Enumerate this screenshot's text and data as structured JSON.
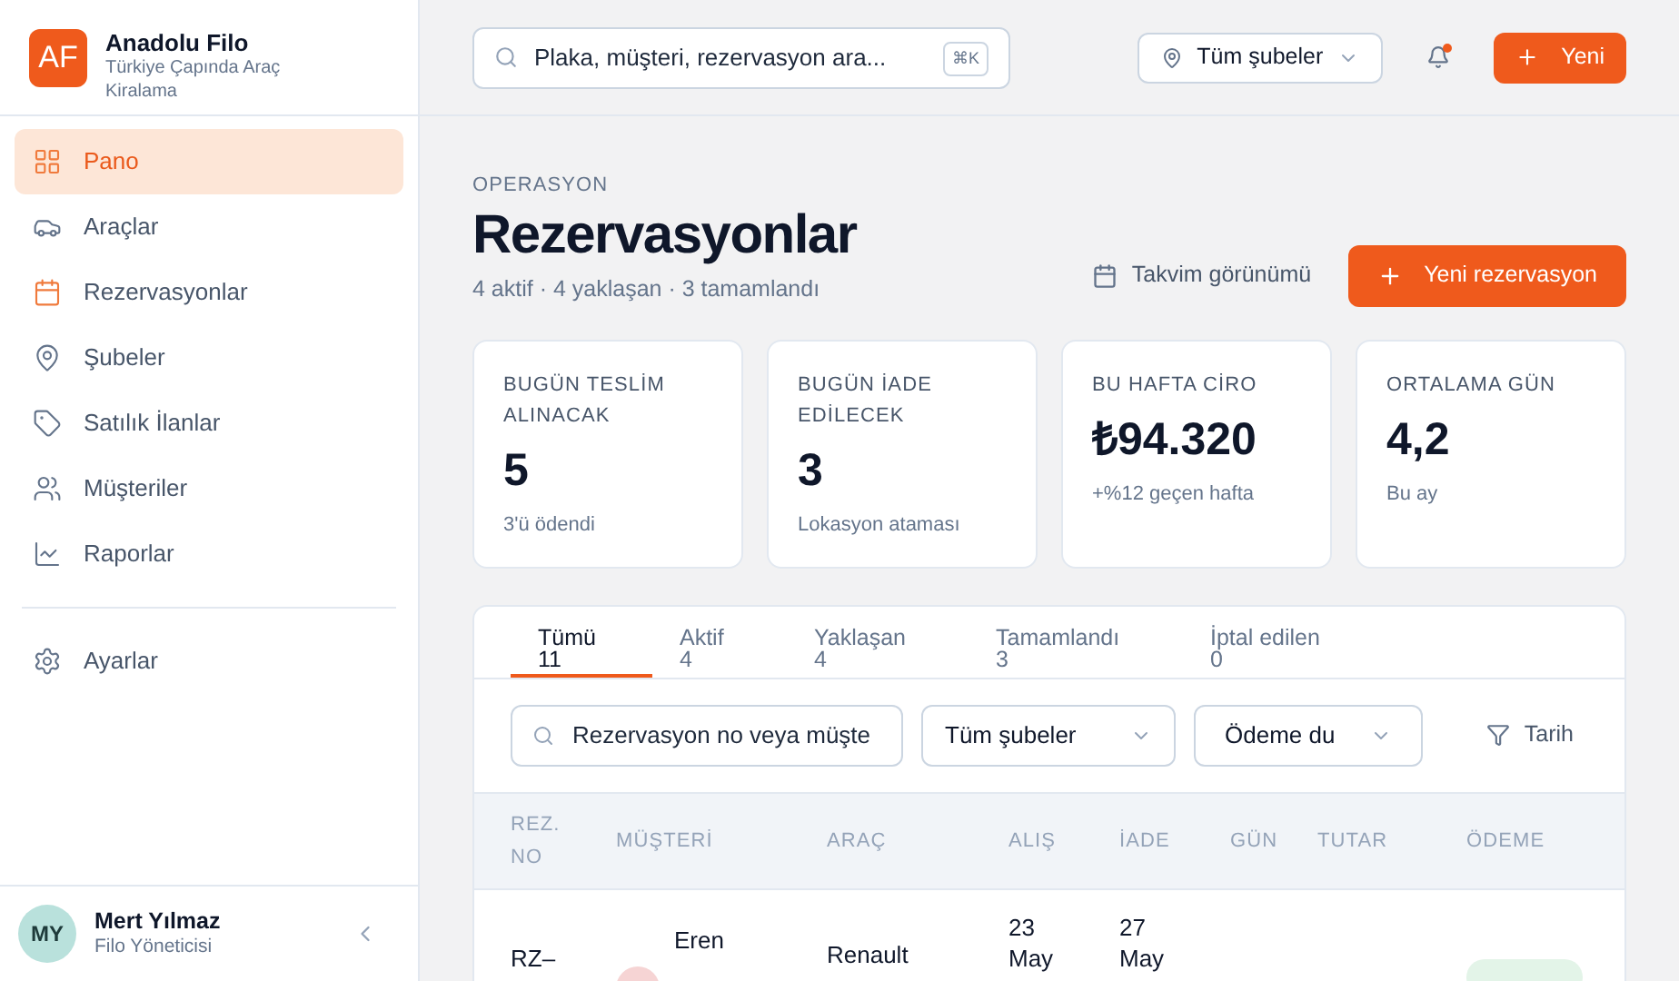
{
  "brand": {
    "logo": "AF",
    "name": "Anadolu Filo",
    "tagline": "Türkiye Çapında Araç Kiralama"
  },
  "sidebar": {
    "items": [
      {
        "kind": "grid",
        "label": "Pano",
        "selected": true
      },
      {
        "kind": "car",
        "label": "Araçlar",
        "selected": false
      },
      {
        "kind": "calendar",
        "label": "Rezervasyonlar",
        "selected": false
      },
      {
        "kind": "pin",
        "label": "Şubeler",
        "selected": false
      },
      {
        "kind": "tag",
        "label": "Satılık İlanlar",
        "selected": false
      },
      {
        "kind": "users",
        "label": "Müşteriler",
        "selected": false
      },
      {
        "kind": "chart",
        "label": "Raporlar",
        "selected": false
      }
    ],
    "settings": {
      "kind": "gear",
      "label": "Ayarlar",
      "selected": false
    },
    "user": {
      "initials": "MY",
      "name": "Mert Yılmaz",
      "role": "Filo Yöneticisi"
    }
  },
  "topbar": {
    "search": {
      "placeholder": "Plaka, müşteri, rezervasyon ara...",
      "shortcut": "⌘K"
    },
    "branch": "Tüm şubeler",
    "notification": true,
    "new_button": "Yeni"
  },
  "page": {
    "eyebrow": "OPERASYON",
    "title": "Rezervasyonlar",
    "subtitle": "4 aktif · 4 yaklaşan · 3 tamamlandı",
    "calendar_view": "Takvim görünümü",
    "new_reservation": "Yeni rezervasyon"
  },
  "stats": [
    {
      "label": "BUGÜN TESLİM ALINACAK",
      "value": "5",
      "note": "3'ü ödendi"
    },
    {
      "label": "BUGÜN İADE EDİLECEK",
      "value": "3",
      "note": "Lokasyon ataması"
    },
    {
      "label": "BU HAFTA CİRO",
      "value": "₺94.320",
      "note": "+%12 geçen hafta"
    },
    {
      "label": "ORTALAMA GÜN",
      "value": "4,2",
      "note": "Bu ay"
    }
  ],
  "tabs": [
    {
      "label": "Tümü",
      "count": "11",
      "selected": true
    },
    {
      "label": "Aktif",
      "count": "4",
      "selected": false
    },
    {
      "label": "Yaklaşan",
      "count": "4",
      "selected": false
    },
    {
      "label": "Tamamlandı",
      "count": "3",
      "selected": false
    },
    {
      "label": "İptal edilen",
      "count": "0",
      "selected": false
    }
  ],
  "filters": {
    "search_placeholder": "Rezervasyon no veya müşte",
    "branch": "Tüm şubeler",
    "payment": "Ödeme du",
    "date": "Tarih"
  },
  "table": {
    "columns": [
      "REZ. NO",
      "MÜŞTERİ",
      "ARAÇ",
      "ALIŞ",
      "İADE",
      "GÜN",
      "TUTAR",
      "ÖDEME"
    ],
    "rows": [
      {
        "id": "RZ–",
        "customer": "Eren",
        "vehicle": "Renault",
        "pickup": "23 May",
        "return": "27 May"
      }
    ]
  }
}
